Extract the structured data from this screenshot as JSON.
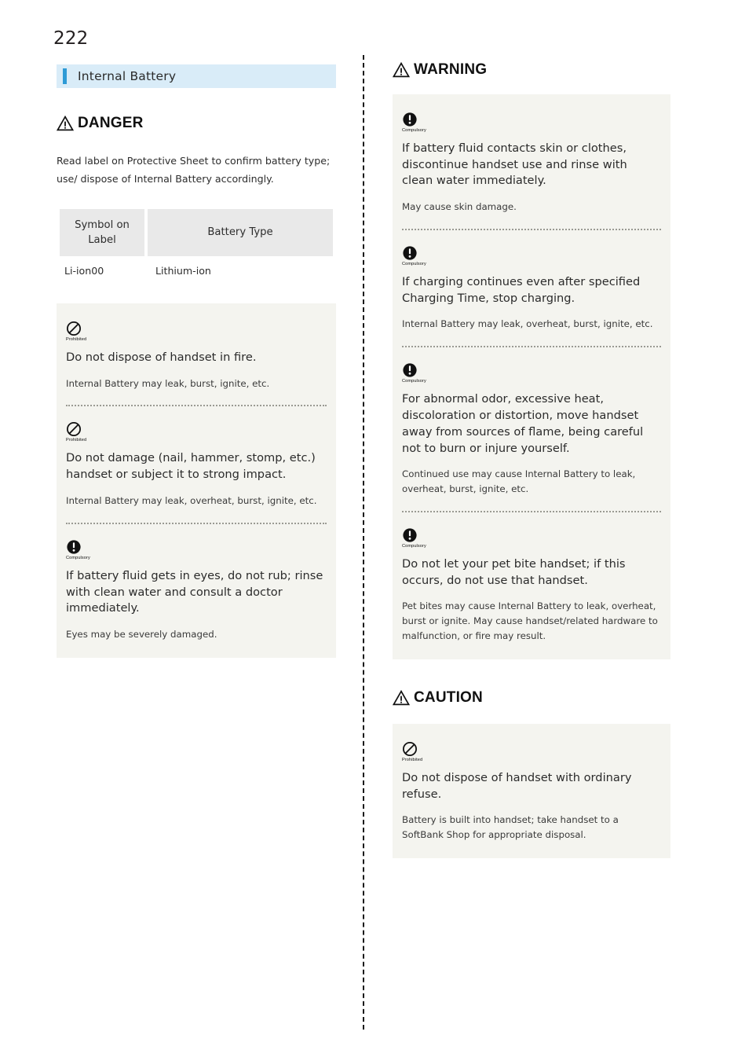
{
  "page": {
    "number": "222"
  },
  "section": {
    "title": "Internal Battery",
    "accent_color": "#2e9bd6",
    "bar_background": "#d9ecf8"
  },
  "icons": {
    "warning_triangle": "warning-triangle-icon",
    "prohibited": "prohibited-icon",
    "compulsory": "compulsory-icon"
  },
  "left_column": {
    "danger": {
      "label": "DANGER",
      "intro": "Read label on Protective Sheet to confirm battery type; use/ dispose of Internal Battery accordingly.",
      "table": {
        "headers": [
          "Symbol on Label",
          "Battery Type"
        ],
        "rows": [
          [
            "Li-ion00",
            "Lithium-ion"
          ]
        ]
      },
      "notices": [
        {
          "symbol": "Prohibited",
          "main": "Do not dispose of handset in fire.",
          "sub": "Internal Battery may leak, burst, ignite, etc."
        },
        {
          "symbol": "Prohibited",
          "main": "Do not damage (nail, hammer, stomp, etc.) handset or subject it to strong impact.",
          "sub": "Internal Battery may leak, overheat, burst, ignite, etc."
        },
        {
          "symbol": "Compulsory",
          "main": "If battery fluid gets in eyes, do not rub; rinse with clean water and consult a doctor immediately.",
          "sub": "Eyes may be severely damaged."
        }
      ]
    }
  },
  "right_column": {
    "warning": {
      "label": "WARNING",
      "notices": [
        {
          "symbol": "Compulsory",
          "main": "If battery fluid contacts skin or clothes, discontinue handset use and rinse with clean water immediately.",
          "sub": "May cause skin damage."
        },
        {
          "symbol": "Compulsory",
          "main": "If charging continues even after specified Charging Time, stop charging.",
          "sub": "Internal Battery may leak, overheat, burst, ignite, etc."
        },
        {
          "symbol": "Compulsory",
          "main": "For abnormal odor, excessive heat, discoloration or distortion, move handset away from sources of flame, being careful not to burn or injure yourself.",
          "sub": "Continued use may cause Internal Battery to leak, overheat, burst, ignite, etc."
        },
        {
          "symbol": "Compulsory",
          "main": "Do not let your pet bite handset; if this occurs, do not use that handset.",
          "sub": "Pet bites may cause Internal Battery to leak, overheat, burst or ignite. May cause handset/related hardware to malfunction, or fire may result."
        }
      ]
    },
    "caution": {
      "label": "CAUTION",
      "notices": [
        {
          "symbol": "Prohibited",
          "main": "Do not dispose of handset with ordinary refuse.",
          "sub": "Battery is built into handset; take handset to a SoftBank Shop for appropriate disposal."
        }
      ]
    }
  }
}
